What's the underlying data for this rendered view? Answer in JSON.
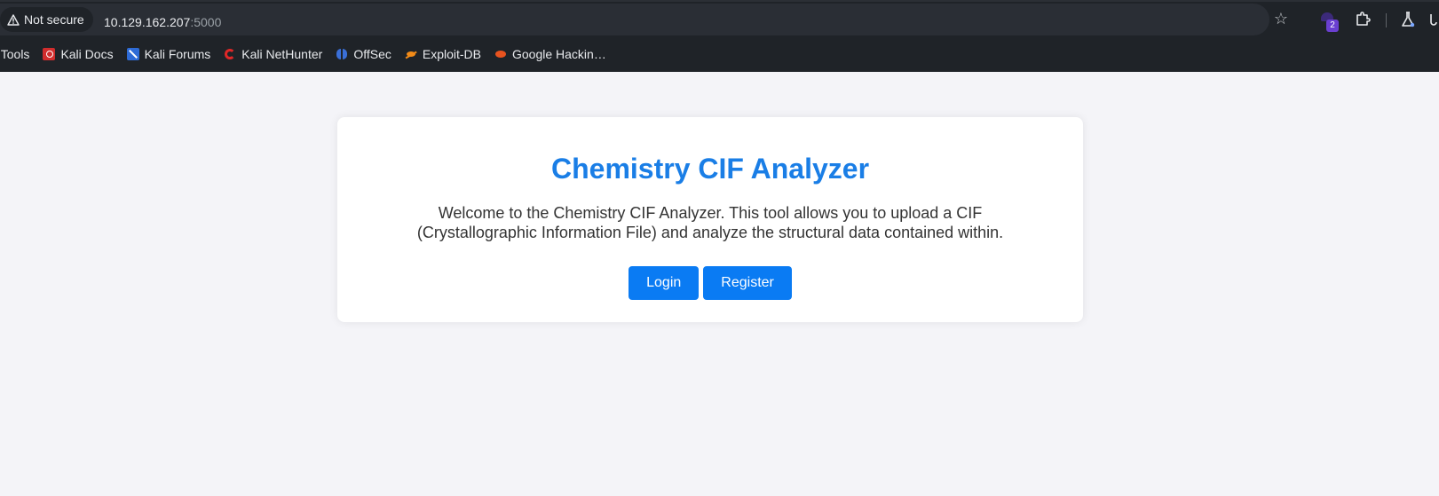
{
  "browser": {
    "security_label": "Not secure",
    "url_host": "10.129.162.207",
    "url_port": ":5000",
    "extension_badge_count": "2",
    "icons": [
      "warning-icon",
      "star-icon",
      "extension-icon",
      "puzzle-icon",
      "flask-icon"
    ]
  },
  "bookmarks": [
    {
      "label": "i Tools",
      "icon": "kali-tools-icon"
    },
    {
      "label": "Kali Docs",
      "icon": "kali-docs-icon"
    },
    {
      "label": "Kali Forums",
      "icon": "kali-forums-icon"
    },
    {
      "label": "Kali NetHunter",
      "icon": "kali-nethunter-icon"
    },
    {
      "label": "OffSec",
      "icon": "offsec-icon"
    },
    {
      "label": "Exploit-DB",
      "icon": "exploit-db-icon"
    },
    {
      "label": "Google Hackin…",
      "icon": "google-hacking-icon"
    }
  ],
  "page": {
    "title": "Chemistry CIF Analyzer",
    "description": "Welcome to the Chemistry CIF Analyzer. This tool allows you to upload a CIF (Crystallographic Information File) and analyze the structural data contained within.",
    "login_label": "Login",
    "register_label": "Register"
  },
  "colors": {
    "accent": "#0a7bf3",
    "title": "#1a7ee6",
    "page_background": "#f4f4f8",
    "browser_chrome": "#1f2328"
  }
}
